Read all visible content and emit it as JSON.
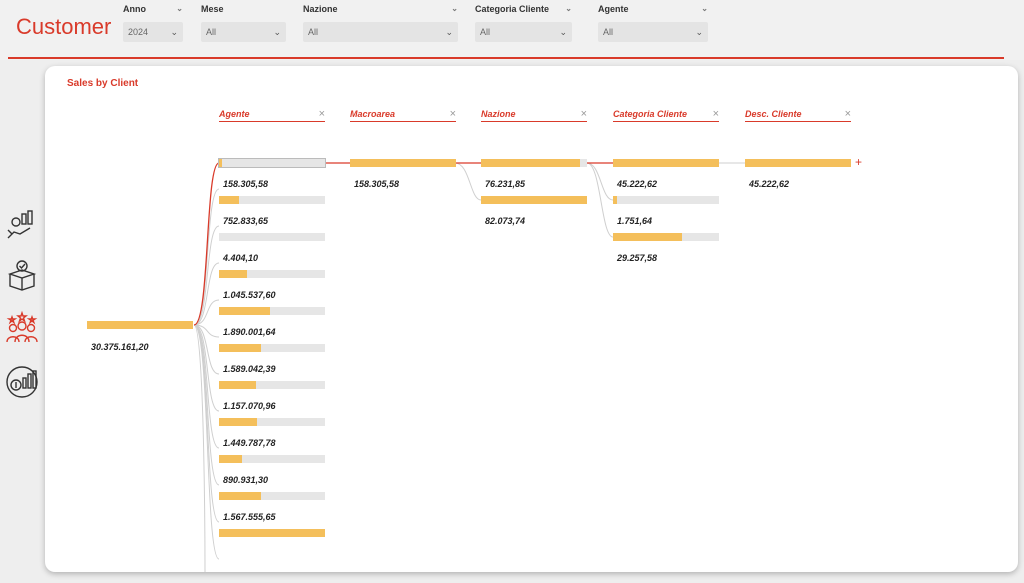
{
  "header": {
    "title": "Customer"
  },
  "filters": [
    {
      "label": "Anno",
      "value": "2024"
    },
    {
      "label": "Mese",
      "value": "All"
    },
    {
      "label": "Nazione",
      "value": "All"
    },
    {
      "label": "Categoria Cliente",
      "value": "All"
    },
    {
      "label": "Agente",
      "value": "All"
    }
  ],
  "sidebar": {
    "icons": [
      "hand-money-growth-icon",
      "box-check-icon",
      "team-stars-icon",
      "coin-chart-icon"
    ],
    "active": "team-stars-icon"
  },
  "visual": {
    "title": "Sales by Client",
    "columns": [
      "Agente",
      "Macroarea",
      "Nazione",
      "Categoria Cliente",
      "Desc. Cliente"
    ],
    "root": {
      "value": "30.375.161,20"
    },
    "agente_values": [
      "158.305,58",
      "752.833,65",
      "4.404,10",
      "1.045.537,60",
      "1.890.001,64",
      "1.589.042,39",
      "1.157.070,96",
      "1.449.787,78",
      "890.931,30",
      "1.567.555,65"
    ],
    "agente_fill": [
      0.03,
      0.19,
      0.0,
      0.26,
      0.48,
      0.4,
      0.35,
      0.36,
      0.22,
      0.4,
      1.0
    ],
    "macroarea_values": [
      "158.305,58"
    ],
    "nazione_values": [
      "76.231,85",
      "82.073,74"
    ],
    "categoria_values": [
      "45.222,62",
      "1.751,64",
      "29.257,58"
    ],
    "desc_values": [
      "45.222,62"
    ]
  },
  "colors": {
    "accent": "#d93a2a",
    "bar": "#f4bf5b",
    "track": "#e6e6e6"
  }
}
